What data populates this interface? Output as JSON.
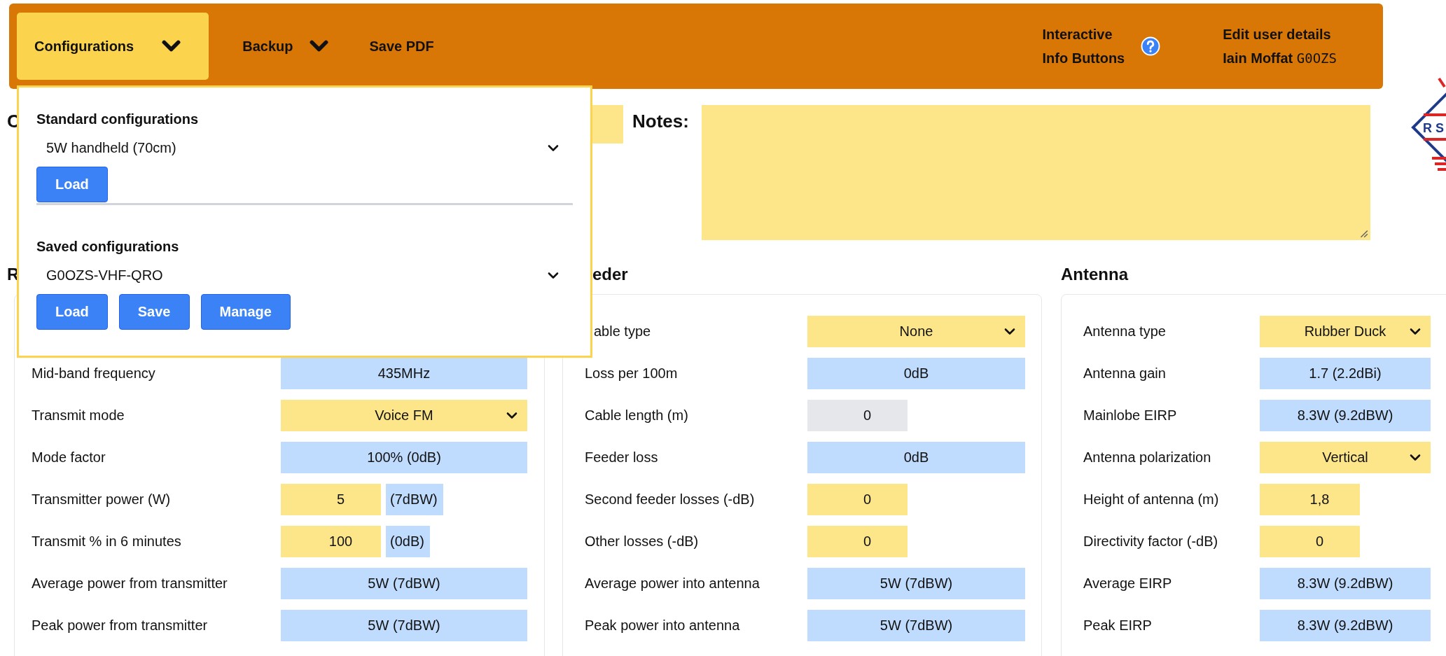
{
  "top_bar": {
    "menus": [
      {
        "label": "Configurations",
        "selected": true,
        "dropdown": true
      },
      {
        "label": "Backup",
        "selected": false,
        "dropdown": true
      },
      {
        "label": "Save PDF",
        "selected": false,
        "dropdown": false
      }
    ],
    "info_toggle": {
      "lines": [
        "Interactive",
        "Info Buttons"
      ]
    },
    "user": {
      "link": "Edit user details",
      "name": "Iain Moffat",
      "callsign": "G0OZS"
    }
  },
  "config_menu": {
    "sections": [
      {
        "title": "Standard configurations",
        "selection": "5W handheld (70cm)",
        "buttons": [
          "Load"
        ]
      },
      {
        "title": "Saved configurations",
        "selection": "G0OZS-VHF-QRO",
        "buttons": [
          "Load",
          "Save",
          "Manage"
        ]
      }
    ]
  },
  "configuration": {
    "label": "C"
  },
  "notes": {
    "label": "Notes:"
  },
  "logo": {
    "text": "R S"
  },
  "panels": [
    {
      "title": "R",
      "rows": [
        {
          "label": "Mid-band frequency",
          "kind": "output",
          "value": "435MHz"
        },
        {
          "label": "Transmit mode",
          "kind": "select",
          "value": "Voice FM"
        },
        {
          "label": "Mode factor",
          "kind": "output",
          "value": "100% (0dB)"
        },
        {
          "label": "Transmitter power (W)",
          "kind": "input",
          "value": "5",
          "unit": "(7dBW)"
        },
        {
          "label": "Transmit % in 6 minutes",
          "kind": "input",
          "value": "100",
          "unit": "(0dB)"
        },
        {
          "label": "Average power from transmitter",
          "kind": "output",
          "value": "5W (7dBW)"
        },
        {
          "label": "Peak power from transmitter",
          "kind": "output",
          "value": "5W (7dBW)"
        }
      ]
    },
    {
      "title": "eder",
      "rows": [
        {
          "label": "able type",
          "kind": "select",
          "value": "None"
        },
        {
          "label": "Loss per 100m",
          "kind": "output",
          "value": "0dB"
        },
        {
          "label": "Cable length (m)",
          "kind": "disabled",
          "value": "0"
        },
        {
          "label": "Feeder loss",
          "kind": "output",
          "value": "0dB"
        },
        {
          "label": "Second feeder losses (-dB)",
          "kind": "input",
          "value": "0"
        },
        {
          "label": "Other losses (-dB)",
          "kind": "input",
          "value": "0"
        },
        {
          "label": "Average power into antenna",
          "kind": "output",
          "value": "5W (7dBW)"
        },
        {
          "label": "Peak power into antenna",
          "kind": "output",
          "value": "5W (7dBW)"
        }
      ]
    },
    {
      "title": "Antenna",
      "rows": [
        {
          "label": "Antenna type",
          "kind": "select",
          "value": "Rubber Duck"
        },
        {
          "label": "Antenna gain",
          "kind": "output",
          "value": "1.7 (2.2dBi)"
        },
        {
          "label": "Mainlobe EIRP",
          "kind": "output",
          "value": "8.3W (9.2dBW)"
        },
        {
          "label": "Antenna polarization",
          "kind": "select",
          "value": "Vertical"
        },
        {
          "label": "Height of antenna (m)",
          "kind": "input",
          "value": "1,8"
        },
        {
          "label": "Directivity factor (-dB)",
          "kind": "input",
          "value": "0"
        },
        {
          "label": "Average EIRP",
          "kind": "output",
          "value": "8.3W (9.2dBW)"
        },
        {
          "label": "Peak EIRP",
          "kind": "output",
          "value": "8.3W (9.2dBW)"
        }
      ]
    }
  ]
}
